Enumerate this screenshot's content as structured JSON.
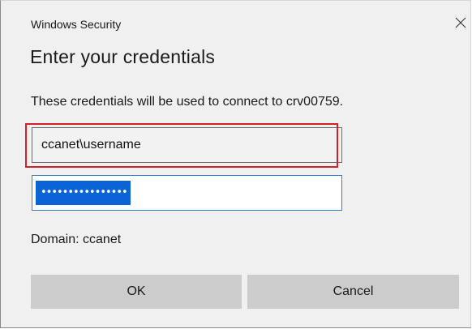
{
  "window": {
    "title": "Windows Security",
    "close_icon": "close-icon"
  },
  "main": {
    "heading": "Enter your credentials",
    "message": "These credentials will be used to connect to crv00759.",
    "username_value": "ccanet\\username",
    "password_mask": "••••••••••••••••",
    "domain_text": "Domain: ccanet"
  },
  "buttons": {
    "ok_label": "OK",
    "cancel_label": "Cancel"
  },
  "colors": {
    "highlight_box": "#d81e26",
    "selection": "#0a64d6",
    "focus_border": "#2f7fd6",
    "button_bg": "#cccccc"
  }
}
